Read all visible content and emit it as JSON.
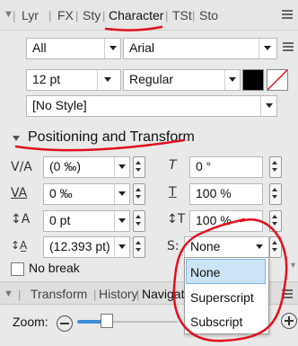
{
  "tabs": [
    {
      "label": "Lyr"
    },
    {
      "label": "FX"
    },
    {
      "label": "Sty"
    },
    {
      "label": "Character"
    },
    {
      "label": "TSt"
    },
    {
      "label": "Sto"
    }
  ],
  "character": {
    "font_collection": "All",
    "font_family": "Arial",
    "font_size": "12 pt",
    "font_style": "Regular",
    "text_style": "[No Style]"
  },
  "section": {
    "title": "Positioning and Transform"
  },
  "rows": {
    "tracking": "(0 ‰)",
    "baseline_rotation": "0 °",
    "kerning": "0 ‰",
    "horizontal_scale": "100 %",
    "baseline_shift": "0 pt",
    "vertical_scale": "100 %",
    "leading": "(12.393 pt)",
    "position": "None"
  },
  "position_options": [
    "None",
    "Superscript",
    "Subscript"
  ],
  "no_break_label": "No break",
  "bottom_tabs": [
    {
      "label": "Transform"
    },
    {
      "label": "History"
    },
    {
      "label": "Navigator"
    }
  ],
  "zoom_label": "Zoom:",
  "colors": {
    "accent": "#3b8fd9",
    "annotation": "#e0101e",
    "selected": "#cce4f7",
    "fill": "#000000"
  }
}
